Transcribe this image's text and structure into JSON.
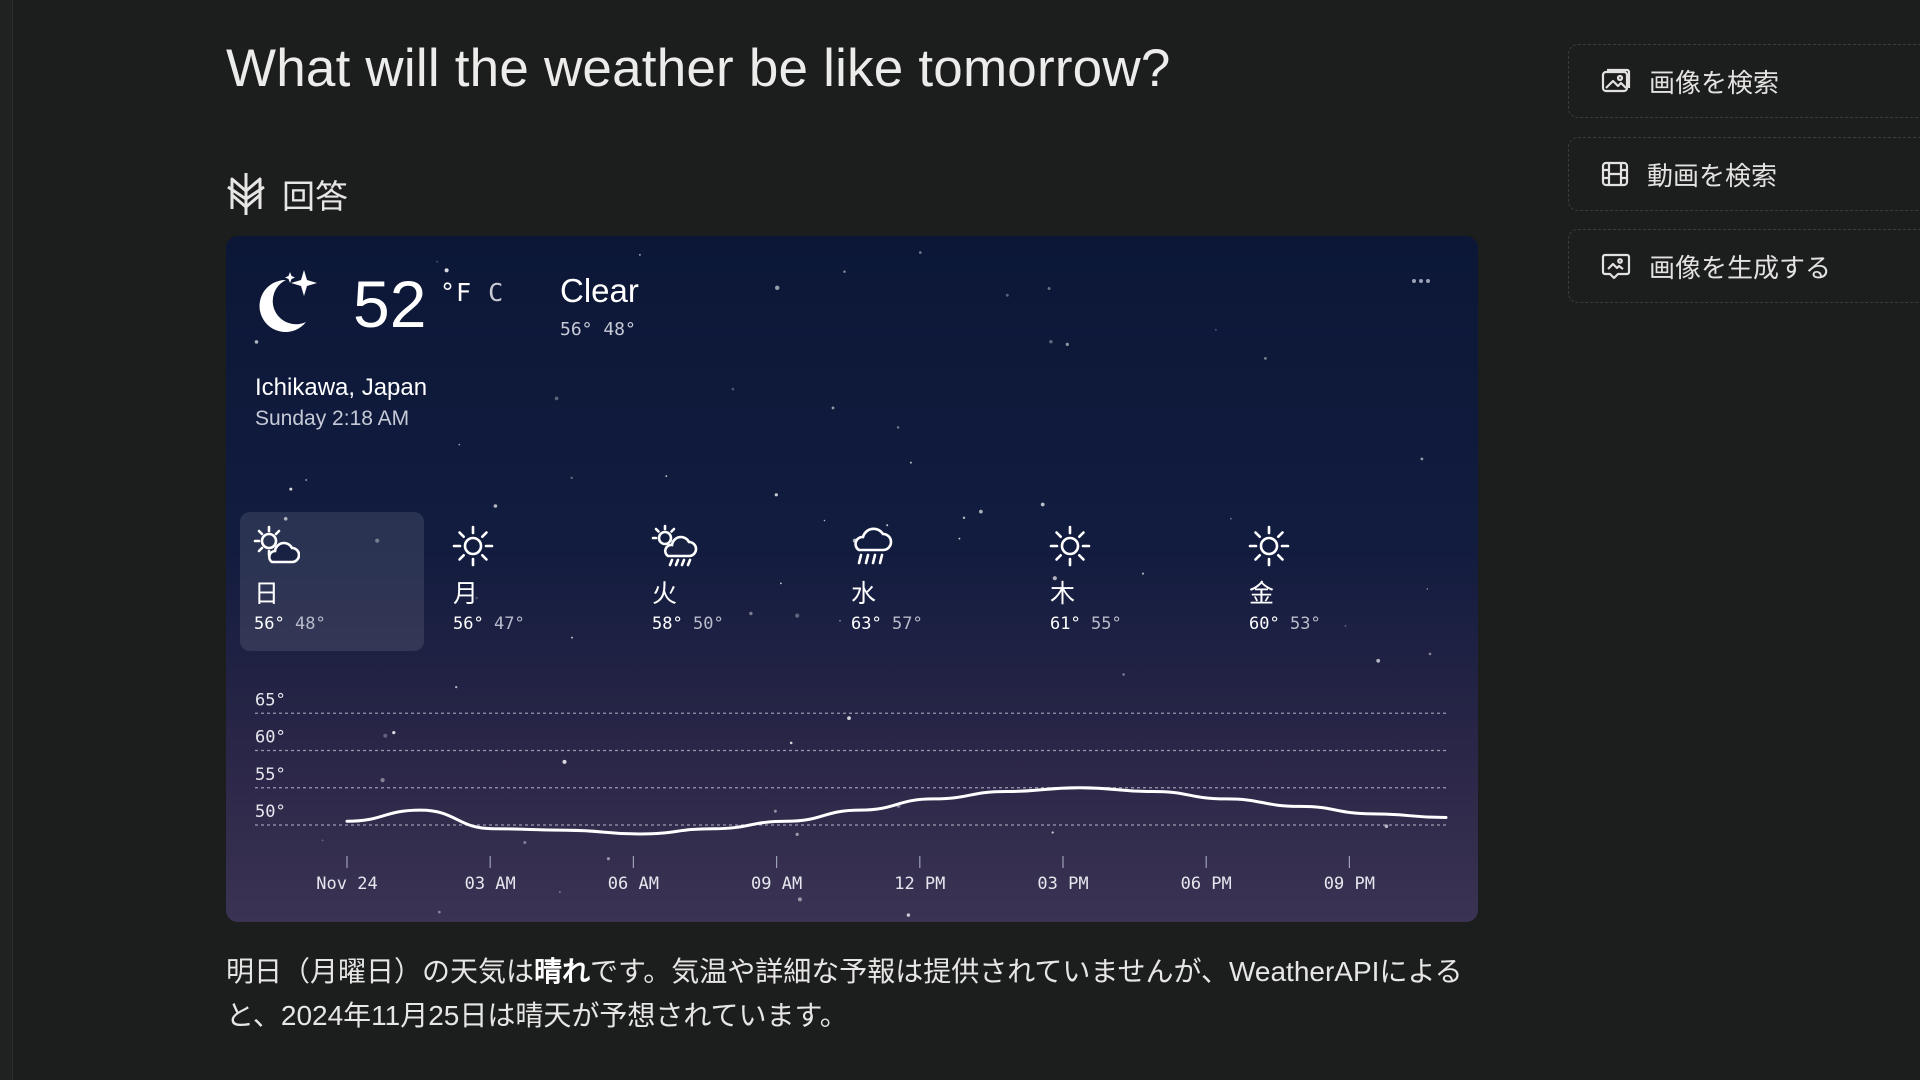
{
  "question": "What will the weather be like tomorrow?",
  "answer_header": {
    "label": "回答",
    "icon": "answer-icon"
  },
  "weather": {
    "current_temp": "52",
    "unit_active": "°F",
    "unit_other": "C",
    "condition": "Clear",
    "hi_lo": "56° 48°",
    "location": "Ichikawa, Japan",
    "datetime": "Sunday 2:18 AM",
    "current_icon": "moon-stars-icon",
    "days": [
      {
        "name": "日",
        "high": "56°",
        "low": "48°",
        "icon": "sun-cloud-icon",
        "selected": true
      },
      {
        "name": "月",
        "high": "56°",
        "low": "47°",
        "icon": "sun-icon"
      },
      {
        "name": "火",
        "high": "58°",
        "low": "50°",
        "icon": "sun-cloud-rain-icon"
      },
      {
        "name": "水",
        "high": "63°",
        "low": "57°",
        "icon": "rain-cloud-icon"
      },
      {
        "name": "木",
        "high": "61°",
        "low": "55°",
        "icon": "sun-icon"
      },
      {
        "name": "金",
        "high": "60°",
        "low": "53°",
        "icon": "sun-icon"
      }
    ]
  },
  "chart_data": {
    "type": "line",
    "x": [
      "Nov 24 00:00",
      "01:30",
      "03:00",
      "04:30",
      "06:00",
      "07:30",
      "09:00",
      "10:30",
      "12:00",
      "13:30",
      "15:00",
      "16:30",
      "18:00",
      "19:30",
      "21:00",
      "22:30"
    ],
    "series": [
      {
        "values": [
          50.5,
          52,
          49.5,
          49.3,
          48.8,
          49.5,
          50.5,
          52,
          53.5,
          54.5,
          55,
          54.5,
          53.5,
          52.5,
          51.5,
          51
        ]
      }
    ],
    "y_ticks": [
      "65°",
      "60°",
      "55°",
      "50°"
    ],
    "y_tick_values": [
      65,
      60,
      55,
      50
    ],
    "x_ticks": [
      "Nov 24",
      "03 AM",
      "06 AM",
      "09 AM",
      "12 PM",
      "03 PM",
      "06 PM",
      "09 PM"
    ],
    "ylim": [
      48,
      66
    ],
    "grid": true
  },
  "answer": {
    "part1": "明日（月曜日）の天気は",
    "bold": "晴れ",
    "part2": "です。気温や詳細な予報は提供されていませんが、WeatherAPIによると、2024年11月25日は晴天が予想されています。"
  },
  "side_buttons": [
    {
      "label": "画像を検索",
      "icon": "image-icon"
    },
    {
      "label": "動画を検索",
      "icon": "film-icon"
    },
    {
      "label": "画像を生成する",
      "icon": "image-generate-icon"
    }
  ]
}
